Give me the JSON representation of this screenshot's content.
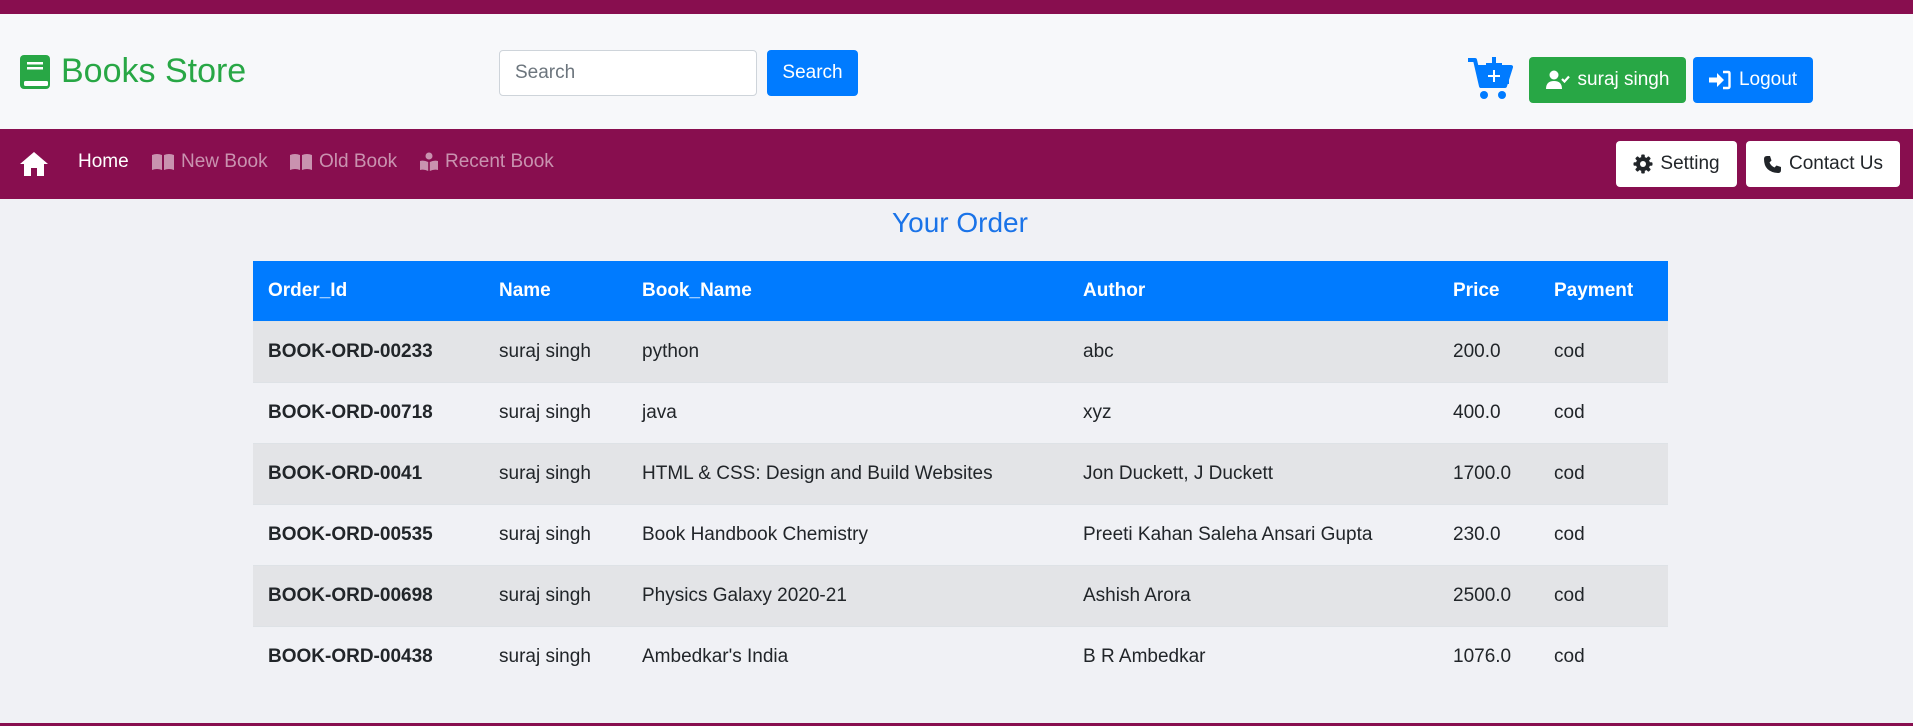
{
  "brand": {
    "name": "Books Store",
    "color": "#28a745"
  },
  "search": {
    "placeholder": "Search",
    "button_label": "Search"
  },
  "user": {
    "name": "suraj singh",
    "logout_label": "Logout"
  },
  "navbar": {
    "bg_color": "#880e4f",
    "items": [
      {
        "label": "Home",
        "icon": "home-icon",
        "active": true
      },
      {
        "label": "New Book",
        "icon": "book-open-icon"
      },
      {
        "label": "Old Book",
        "icon": "book-open-icon"
      },
      {
        "label": "Recent Book",
        "icon": "book-reader-icon"
      }
    ],
    "setting_label": "Setting",
    "contact_label": "Contact Us"
  },
  "main": {
    "title": "Your Order",
    "columns": [
      "Order_Id",
      "Name",
      "Book_Name",
      "Author",
      "Price",
      "Payment"
    ],
    "rows": [
      [
        "BOOK-ORD-00233",
        "suraj singh",
        "python",
        "abc",
        "200.0",
        "cod"
      ],
      [
        "BOOK-ORD-00718",
        "suraj singh",
        "java",
        "xyz",
        "400.0",
        "cod"
      ],
      [
        "BOOK-ORD-0041",
        "suraj singh",
        "HTML & CSS: Design and Build Websites",
        "Jon Duckett, J Duckett",
        "1700.0",
        "cod"
      ],
      [
        "BOOK-ORD-00535",
        "suraj singh",
        "Book Handbook Chemistry",
        "Preeti Kahan Saleha Ansari Gupta",
        "230.0",
        "cod"
      ],
      [
        "BOOK-ORD-00698",
        "suraj singh",
        "Physics Galaxy 2020-21",
        "Ashish Arora",
        "2500.0",
        "cod"
      ],
      [
        "BOOK-ORD-00438",
        "suraj singh",
        "Ambedkar's India",
        "B R Ambedkar",
        "1076.0",
        "cod"
      ]
    ]
  },
  "colors": {
    "primary": "#007bff",
    "success": "#28a745",
    "title_blue": "#1a73e8"
  }
}
